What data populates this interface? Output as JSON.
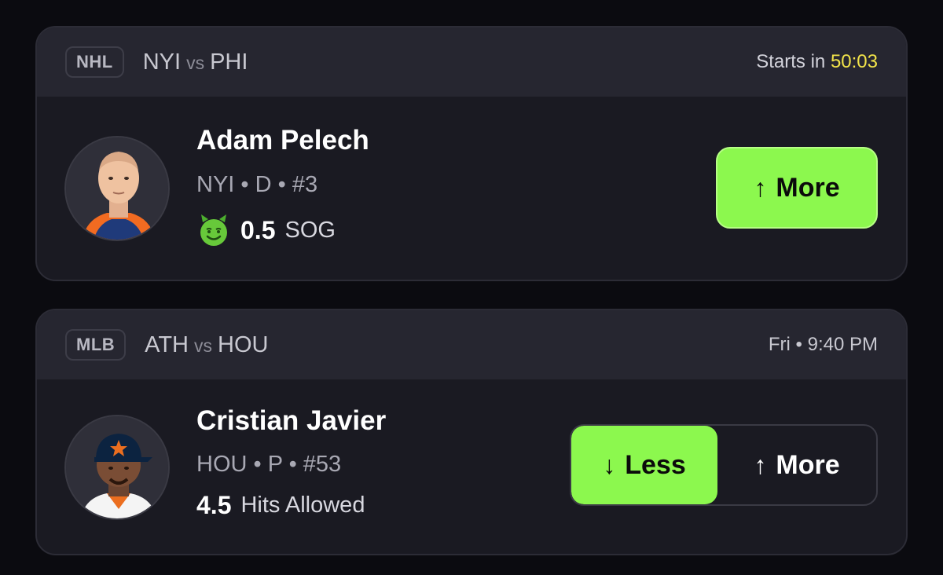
{
  "colors": {
    "accent_green": "#8cf84e",
    "timer_yellow": "#f2e44a",
    "card_bg": "#1a1a22",
    "header_bg": "#262630"
  },
  "cards": [
    {
      "league": "NHL",
      "team_a": "NYI",
      "vs": "vs",
      "team_b": "PHI",
      "starts_label": "Starts in",
      "starts_timer": "50:03",
      "player_name": "Adam Pelech",
      "player_meta": "NYI • D • #3",
      "stat_icon": "green-devil-emoji-icon",
      "stat_value": "0.5",
      "stat_unit": "SOG",
      "more_label": "More",
      "more_arrow": "↑"
    },
    {
      "league": "MLB",
      "team_a": "ATH",
      "vs": "vs",
      "team_b": "HOU",
      "start_time": "Fri • 9:40 PM",
      "player_name": "Cristian Javier",
      "player_meta": "HOU • P • #53",
      "stat_value": "4.5",
      "stat_unit": "Hits Allowed",
      "less_label": "Less",
      "less_arrow": "↓",
      "more_label": "More",
      "more_arrow": "↑",
      "selected": "Less"
    }
  ]
}
